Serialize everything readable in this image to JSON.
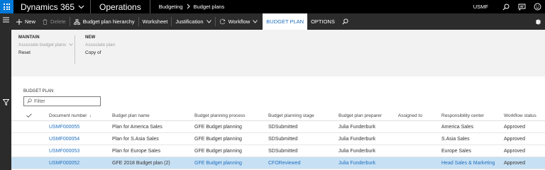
{
  "topbar": {
    "app_name": "Dynamics 365",
    "module_name": "Operations",
    "breadcrumb": [
      "Budgeting",
      "Budget plans"
    ],
    "company": "USMF",
    "icons": [
      "waffle-icon",
      "search-icon",
      "message-icon",
      "smiley-icon"
    ]
  },
  "action_pane": {
    "new_label": "New",
    "delete_label": "Delete",
    "hierarchy_label": "Budget plan hierarchy",
    "worksheet_label": "Worksheet",
    "justification_label": "Justification",
    "workflow_label": "Workflow",
    "budget_plan_tab": "BUDGET PLAN",
    "options_tab": "OPTIONS"
  },
  "ribbon": {
    "maintain": {
      "title": "MAINTAIN",
      "associate_label": "Associate budget plans",
      "reset_label": "Reset"
    },
    "new_group": {
      "title": "NEW",
      "associate_plan_label": "Associate plan",
      "copy_of_label": "Copy of"
    }
  },
  "list": {
    "section_label": "BUDGET PLAN",
    "filter_placeholder": "Filter",
    "columns": {
      "document_number": "Document number",
      "sort_indicator": "↓",
      "plan_name": "Budget plan name",
      "planning_process": "Budget planning process",
      "planning_stage": "Budget planning stage",
      "preparer": "Budget plan preparer",
      "assigned_to": "Assigned to",
      "responsibility_center": "Responsibility center",
      "workflow_status": "Workflow status"
    },
    "rows": [
      {
        "doc": "USMF000055",
        "name": "Plan for America Sales",
        "process": "GFE Budget planning",
        "stage": "SDSubmitted",
        "preparer": "Julia Funderburk",
        "assigned": "",
        "center": "America Sales",
        "status": "Approved"
      },
      {
        "doc": "USMF000054",
        "name": "Plan for S.Asia Sales",
        "process": "GFE Budget planning",
        "stage": "SDSubmitted",
        "preparer": "Julia Funderburk",
        "assigned": "",
        "center": "S.Asia Sales",
        "status": "Approved"
      },
      {
        "doc": "USMF000053",
        "name": "Plan for Europe Sales",
        "process": "GFE Budget planning",
        "stage": "SDSubmitted",
        "preparer": "Julia Funderburk",
        "assigned": "",
        "center": "Europe Sales",
        "status": "Approved"
      },
      {
        "doc": "USMF000052",
        "name": "GFE 2018 Budget plan (2)",
        "process": "GFE Budget planning",
        "stage": "CFOReviewed",
        "preparer": "Julia Funderburk",
        "assigned": "",
        "center": "Head Sales & Marketing",
        "status": "Approved"
      }
    ],
    "selected_row_index": 3
  },
  "colors": {
    "topbar_bg": "#000000",
    "waffle_bg": "#0078d7",
    "action_bg": "#2c2c2c",
    "ribbon_bg": "#f2f2f2",
    "link": "#1f6fbf",
    "selected_row": "#c7e0f4"
  }
}
